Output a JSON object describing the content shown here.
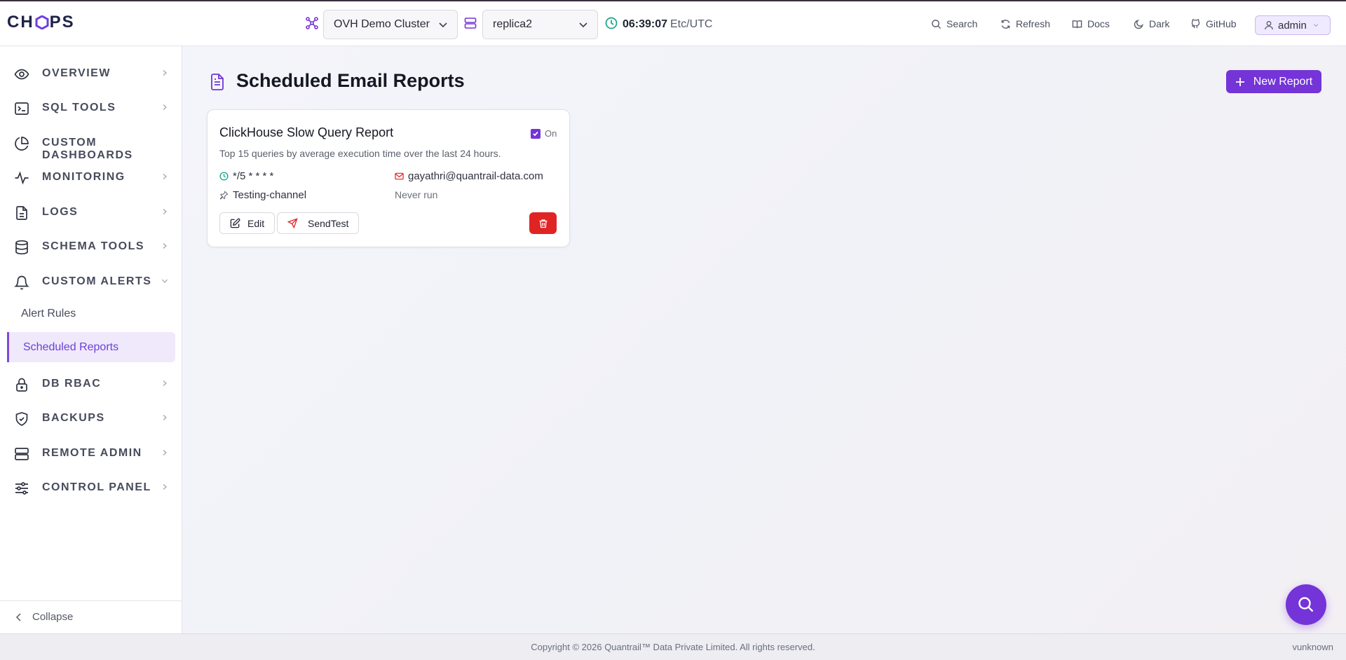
{
  "header": {
    "logo_text": "CHOPS",
    "logo_prefix": "CH",
    "logo_suffix": "PS",
    "cluster": "OVH Demo Cluster",
    "replica": "replica2",
    "time": "06:39:07",
    "timezone": "Etc/UTC",
    "links": {
      "search": "Search",
      "refresh": "Refresh",
      "docs": "Docs",
      "dark": "Dark",
      "github": "GitHub"
    },
    "user": "admin"
  },
  "sidebar": {
    "items": [
      {
        "label": "OVERVIEW",
        "icon": "eye-icon"
      },
      {
        "label": "SQL TOOLS",
        "icon": "terminal-icon"
      },
      {
        "label": "CUSTOM DASHBOARDS",
        "icon": "pie-chart-icon"
      },
      {
        "label": "MONITORING",
        "icon": "activity-icon"
      },
      {
        "label": "LOGS",
        "icon": "file-icon"
      },
      {
        "label": "SCHEMA TOOLS",
        "icon": "database-icon"
      },
      {
        "label": "CUSTOM ALERTS",
        "icon": "bell-icon"
      },
      {
        "label": "DB RBAC",
        "icon": "lock-icon"
      },
      {
        "label": "BACKUPS",
        "icon": "shield-icon"
      },
      {
        "label": "REMOTE ADMIN",
        "icon": "server-icon"
      },
      {
        "label": "CONTROL PANEL",
        "icon": "sliders-icon"
      }
    ],
    "sub_items": [
      {
        "label": "Alert Rules"
      },
      {
        "label": "Scheduled Reports",
        "active": true
      }
    ],
    "collapse_label": "Collapse"
  },
  "main": {
    "title": "Scheduled Email Reports",
    "new_button": "New Report",
    "report": {
      "name": "ClickHouse Slow Query Report",
      "enabled_label": "On",
      "enabled": true,
      "description": "Top 15 queries by average execution time over the last 24 hours.",
      "schedule": "*/5 * * * *",
      "email": "gayathri@quantrail-data.com",
      "channel": "Testing-channel",
      "last_run": "Never run",
      "edit_label": "Edit",
      "send_test_label": "SendTest"
    }
  },
  "footer": {
    "copyright": "Copyright © 2026 Quantrail™ Data Private Limited. All rights reserved.",
    "version": "vunknown"
  },
  "colors": {
    "accent": "#7434d8",
    "danger": "#e02424",
    "teal": "#14a38b"
  }
}
